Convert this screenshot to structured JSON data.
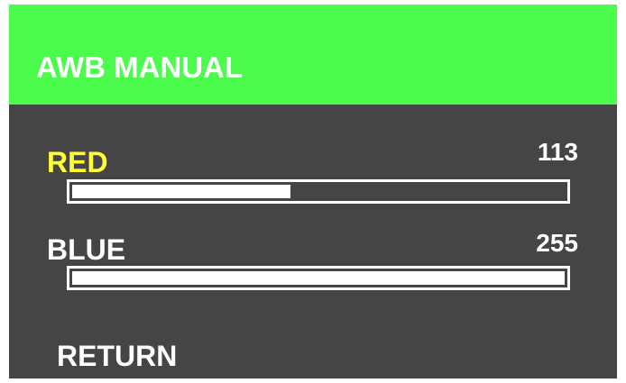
{
  "colors": {
    "header_bg": "#4cfc4c",
    "panel_bg": "#454545",
    "selected_text": "#ffff33",
    "text": "#ffffff"
  },
  "menu": {
    "title": "AWB MANUAL",
    "items": [
      {
        "label": "RED",
        "value": "113",
        "level": 113,
        "max": 255,
        "selected": true
      },
      {
        "label": "BLUE",
        "value": "255",
        "level": 255,
        "max": 255,
        "selected": false
      }
    ],
    "return_label": "RETURN"
  }
}
